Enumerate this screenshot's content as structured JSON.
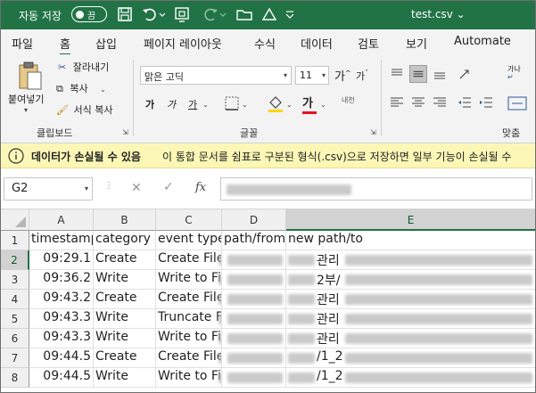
{
  "titlebar": {
    "autosave_label": "자동 저장",
    "autosave_state": "끔",
    "filename": "test.csv ⌄"
  },
  "tabs": [
    {
      "label": "파일",
      "active": false
    },
    {
      "label": "홈",
      "active": true
    },
    {
      "label": "삽입",
      "active": false
    },
    {
      "label": "페이지 레이아웃",
      "active": false
    },
    {
      "label": "수식",
      "active": false
    },
    {
      "label": "데이터",
      "active": false
    },
    {
      "label": "검토",
      "active": false
    },
    {
      "label": "보기",
      "active": false
    },
    {
      "label": "Automate",
      "active": false
    }
  ],
  "ribbon": {
    "paste_label": "붙여넣기",
    "cut_label": "잘라내기",
    "copy_label": "복사",
    "format_painter_label": "서식 복사",
    "clipboard_group": "클립보드",
    "font_name": "맑은 고딕",
    "font_size": "11",
    "grow_font": "가",
    "shrink_font": "가",
    "bold": "가",
    "italic": "가",
    "underline": "가",
    "font_color_sample": "가",
    "phonetic_label": "내천",
    "font_group": "글꼴",
    "alignment_group": "맞춤",
    "wrap_label": "가나",
    "accent_color": "#217346",
    "font_color": "#e81123",
    "fill_color": "#ffd400"
  },
  "message": {
    "title": "데이터가 손실될 수 있음",
    "body": "이 통합 문서를 쉼표로 구분된 형식(.csv)으로 저장하면 일부 기능이 손실될 수"
  },
  "formula": {
    "name_box": "G2"
  },
  "sheet": {
    "columns": [
      "A",
      "B",
      "C",
      "D",
      "E"
    ],
    "selected_column": "E",
    "selected_row": "2",
    "rows": [
      {
        "n": "1",
        "a": "timestamp",
        "b": "category",
        "c": "event type",
        "d": "path/from",
        "e": "new path/to"
      },
      {
        "n": "2",
        "a": "09:29.1",
        "b": "Create",
        "c": "Create File",
        "d": "",
        "e": "관리"
      },
      {
        "n": "3",
        "a": "09:36.2",
        "b": "Write",
        "c": "Write to Fi",
        "d": "",
        "e": "2부/"
      },
      {
        "n": "4",
        "a": "09:43.2",
        "b": "Create",
        "c": "Create File",
        "d": "",
        "e": "관리"
      },
      {
        "n": "5",
        "a": "09:43.3",
        "b": "Write",
        "c": "Truncate Fi",
        "d": "",
        "e": "관리"
      },
      {
        "n": "6",
        "a": "09:43.3",
        "b": "Write",
        "c": "Write to Fi",
        "d": "",
        "e": "관리"
      },
      {
        "n": "7",
        "a": "09:44.5",
        "b": "Create",
        "c": "Create File",
        "d": "",
        "e": "/1_2"
      },
      {
        "n": "8",
        "a": "09:44.5",
        "b": "Write",
        "c": "Write to Fi",
        "d": "",
        "e": "/1_2"
      }
    ]
  }
}
